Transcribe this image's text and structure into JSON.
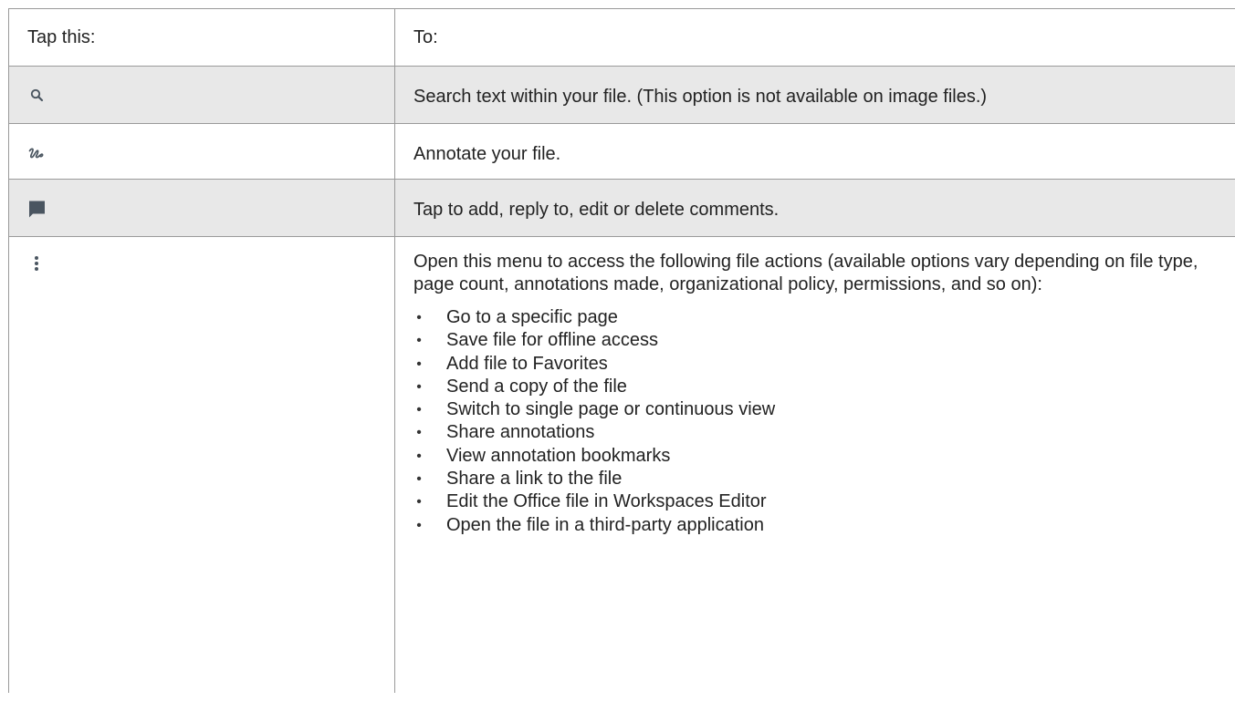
{
  "table": {
    "header": {
      "col1": "Tap this:",
      "col2": "To:"
    },
    "rows": [
      {
        "icon": "search-icon",
        "description": "Search text within your file. (This option is not available on image files.)"
      },
      {
        "icon": "annotate-icon",
        "description": "Annotate your file."
      },
      {
        "icon": "comment-icon",
        "description": "Tap to add, reply to, edit or delete comments."
      },
      {
        "icon": "more-vertical-icon",
        "description": "Open this menu to access the following file actions (available options vary depending on file type, page count, annotations made, organizational policy, permissions, and so on):",
        "actions": [
          "Go to a specific page",
          "Save file for offline access",
          "Add file to Favorites",
          "Send a copy of the file",
          "Switch to single page or continuous view",
          "Share annotations",
          "View annotation bookmarks",
          "Share a link to the file",
          "Edit the Office file in Workspaces Editor",
          "Open the file in a third-party application"
        ]
      }
    ]
  },
  "colors": {
    "shaded_row": "#e8e8e8",
    "border": "#9a9a9a",
    "icon": "#4a5560"
  }
}
